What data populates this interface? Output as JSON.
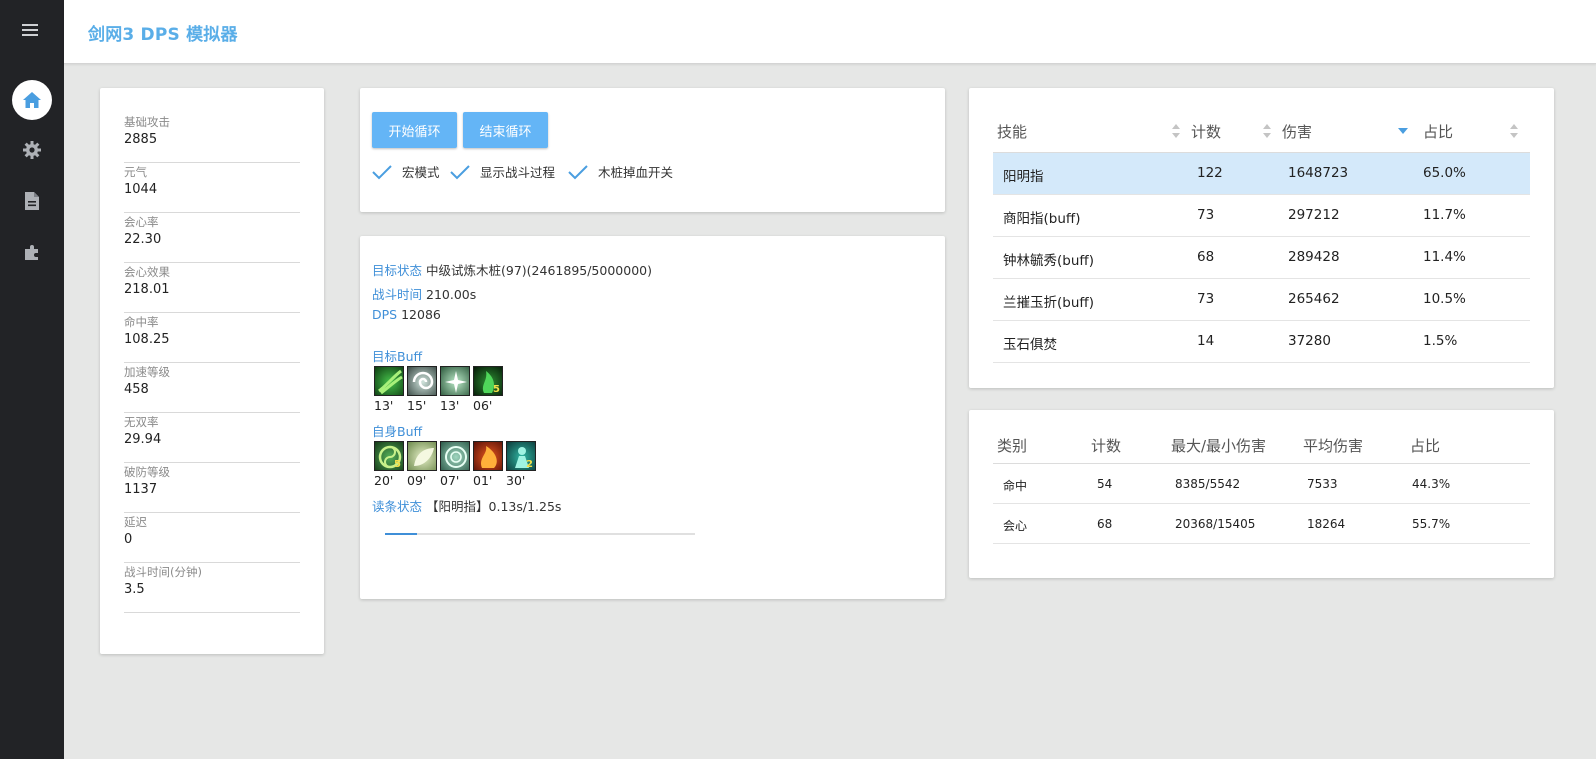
{
  "app": {
    "title": "剑网3 DPS 模拟器"
  },
  "nav": {
    "items": [
      {
        "name": "home-icon",
        "active": true
      },
      {
        "name": "gear-icon",
        "active": false
      },
      {
        "name": "document-icon",
        "active": false
      },
      {
        "name": "puzzle-icon",
        "active": false
      }
    ]
  },
  "attributes": [
    {
      "label": "基础攻击",
      "value": "2885"
    },
    {
      "label": "元气",
      "value": "1044"
    },
    {
      "label": "会心率",
      "value": "22.30"
    },
    {
      "label": "会心效果",
      "value": "218.01"
    },
    {
      "label": "命中率",
      "value": "108.25"
    },
    {
      "label": "加速等级",
      "value": "458"
    },
    {
      "label": "无双率",
      "value": "29.94"
    },
    {
      "label": "破防等级",
      "value": "1137"
    },
    {
      "label": "延迟",
      "value": "0"
    },
    {
      "label": "战斗时间(分钟)",
      "value": "3.5"
    }
  ],
  "controls": {
    "start_label": "开始循环",
    "stop_label": "结束循环",
    "checkboxes": [
      {
        "label": "宏模式",
        "checked": true
      },
      {
        "label": "显示战斗过程",
        "checked": true
      },
      {
        "label": "木桩掉血开关",
        "checked": true
      }
    ]
  },
  "status": {
    "target_label": "目标状态",
    "target_value": "中级试炼木桩(97)(2461895/5000000)",
    "time_label": "战斗时间",
    "time_value": "210.00s",
    "dps_label": "DPS",
    "dps_value": "12086",
    "target_buff_label": "目标Buff",
    "target_buffs": [
      {
        "icon": "green-claw-icon",
        "duration": "13'",
        "stack": ""
      },
      {
        "icon": "white-swirl-icon",
        "duration": "15'",
        "stack": ""
      },
      {
        "icon": "white-burst-icon",
        "duration": "13'",
        "stack": ""
      },
      {
        "icon": "green-flame-icon",
        "duration": "06'",
        "stack": "5"
      }
    ],
    "self_buff_label": "自身Buff",
    "self_buffs": [
      {
        "icon": "yin-yang-icon",
        "duration": "20'",
        "stack": "5"
      },
      {
        "icon": "pale-leaf-icon",
        "duration": "09'",
        "stack": ""
      },
      {
        "icon": "ring-icon",
        "duration": "07'",
        "stack": ""
      },
      {
        "icon": "fire-icon",
        "duration": "01'",
        "stack": ""
      },
      {
        "icon": "teal-figure-icon",
        "duration": "30'",
        "stack": "2"
      }
    ],
    "cast_label": "读条状态",
    "cast_value": "【阳明指】0.13s/1.25s",
    "cast_progress": 0.104,
    "accent_color": "#3f8fd8"
  },
  "skill_table": {
    "headers": [
      "技能",
      "计数",
      "伤害",
      "占比"
    ],
    "sorted_by": "伤害",
    "rows": [
      {
        "skill": "阳明指",
        "count": "122",
        "damage": "1648723",
        "ratio": "65.0%",
        "selected": true
      },
      {
        "skill": "商阳指(buff)",
        "count": "73",
        "damage": "297212",
        "ratio": "11.7%",
        "selected": false
      },
      {
        "skill": "钟林毓秀(buff)",
        "count": "68",
        "damage": "289428",
        "ratio": "11.4%",
        "selected": false
      },
      {
        "skill": "兰摧玉折(buff)",
        "count": "73",
        "damage": "265462",
        "ratio": "10.5%",
        "selected": false
      },
      {
        "skill": "玉石俱焚",
        "count": "14",
        "damage": "37280",
        "ratio": "1.5%",
        "selected": false
      }
    ]
  },
  "category_table": {
    "headers": [
      "类别",
      "计数",
      "最大/最小伤害",
      "平均伤害",
      "占比"
    ],
    "rows": [
      {
        "type": "命中",
        "count": "54",
        "maxmin": "8385/5542",
        "avg": "7533",
        "ratio": "44.3%"
      },
      {
        "type": "会心",
        "count": "68",
        "maxmin": "20368/15405",
        "avg": "18264",
        "ratio": "55.7%"
      }
    ]
  },
  "colors": {
    "nav_bg": "#222326",
    "accent": "#64b5f6",
    "link": "#3f8fd8",
    "selected_row": "#d4e9fa"
  }
}
